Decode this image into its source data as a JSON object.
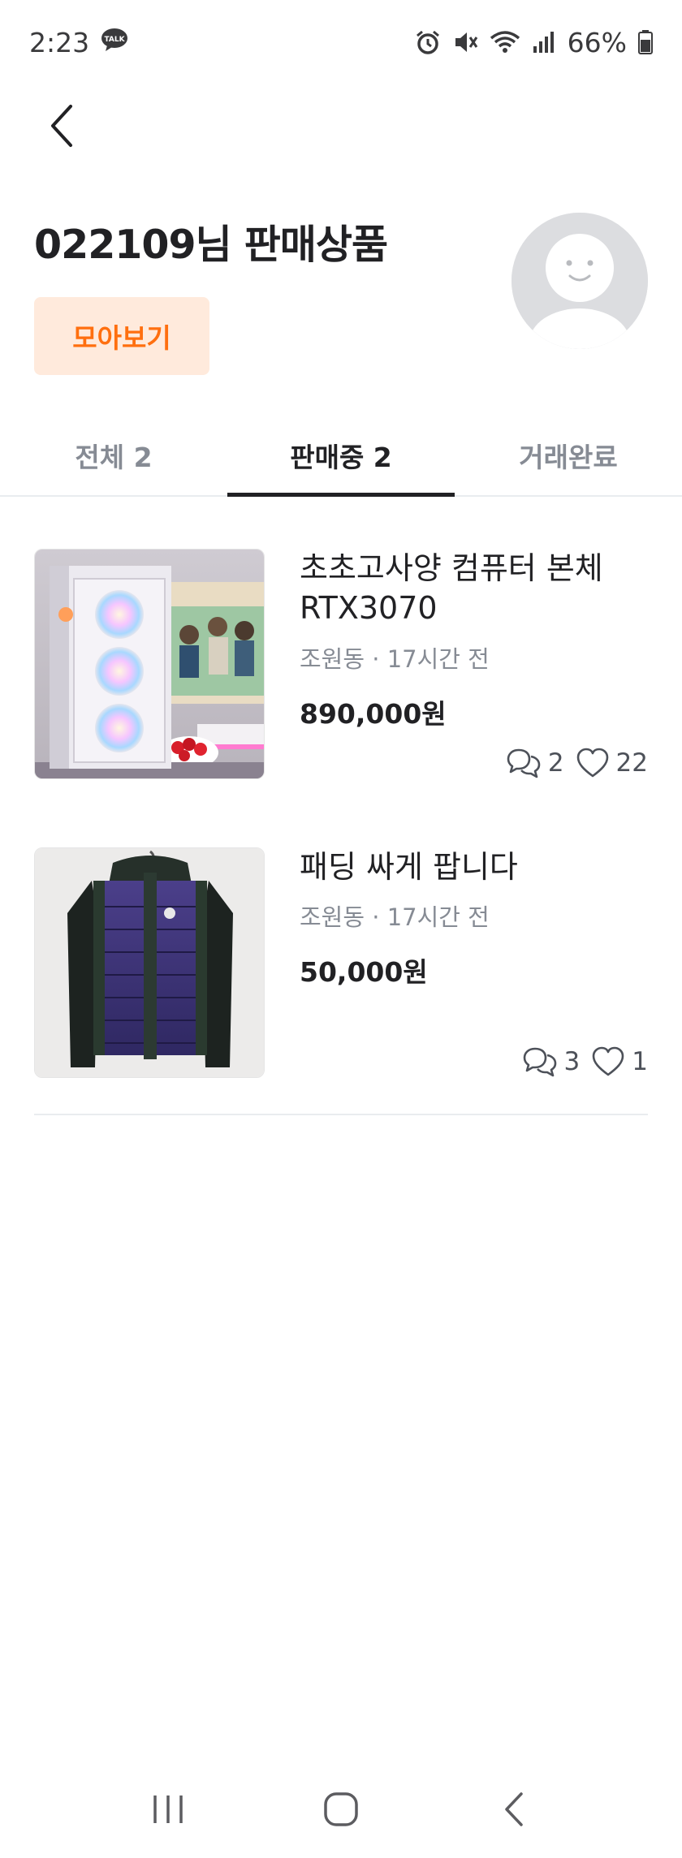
{
  "status_bar": {
    "time": "2:23",
    "battery": "66%",
    "icons": [
      "kakaotalk-icon",
      "alarm-icon",
      "mute-icon",
      "wifi-icon",
      "signal-icon",
      "battery-icon"
    ]
  },
  "header": {
    "title": "022109님 판매상품",
    "collect_label": "모아보기"
  },
  "tabs": [
    {
      "label": "전체 2",
      "active": false
    },
    {
      "label": "판매중 2",
      "active": true
    },
    {
      "label": "거래완료",
      "active": false
    }
  ],
  "products": [
    {
      "title": "초초고사양 컴퓨터 본체 RTX3070",
      "meta": "조원동 · 17시간 전",
      "price": "890,000원",
      "chats": "2",
      "likes": "22"
    },
    {
      "title": "패딩 싸게 팝니다",
      "meta": "조원동 · 17시간 전",
      "price": "50,000원",
      "chats": "3",
      "likes": "1"
    }
  ],
  "colors": {
    "accent": "#ff6f0f",
    "accent_bg": "#ffeadc",
    "text": "#212124",
    "muted": "#868b94"
  }
}
